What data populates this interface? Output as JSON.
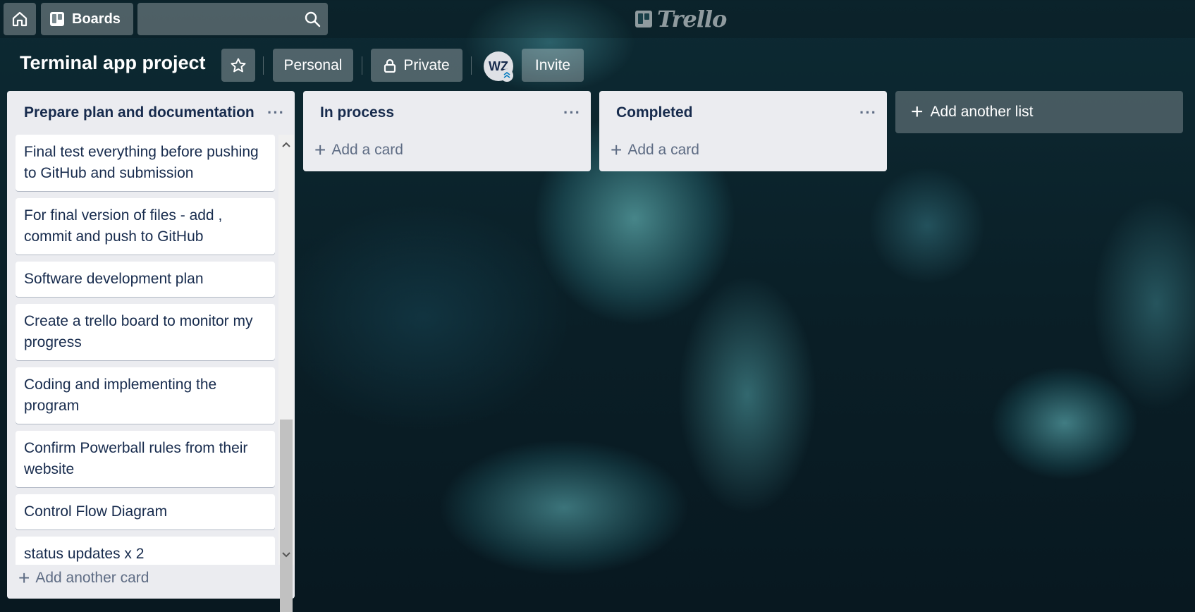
{
  "header": {
    "home_icon": "home-icon",
    "boards_label": "Boards",
    "search_placeholder": "",
    "logo_text": "Trello"
  },
  "board": {
    "title": "Terminal app project",
    "visibility_team": "Personal",
    "visibility_privacy": "Private",
    "member_initials": "WZ",
    "invite_label": "Invite"
  },
  "lists": [
    {
      "title": "Prepare plan and documentation",
      "cards": [
        "Final test everything before pushing to GitHub and submission",
        "For final version of files - add , commit and push to GitHub",
        "Software development plan",
        "Create a trello board to monitor my progress",
        "Coding and implementing the program",
        "Confirm Powerball rules from their website",
        "Control Flow Diagram",
        "status updates x 2"
      ],
      "add_label": "Add another card"
    },
    {
      "title": "In process",
      "cards": [],
      "add_label": "Add a card"
    },
    {
      "title": "Completed",
      "cards": [],
      "add_label": "Add a card"
    }
  ],
  "add_list_label": "Add another list",
  "colors": {
    "list_bg": "#ebecf0",
    "card_bg": "#ffffff",
    "text_primary": "#172b4d",
    "text_muted": "#5e6c84"
  }
}
